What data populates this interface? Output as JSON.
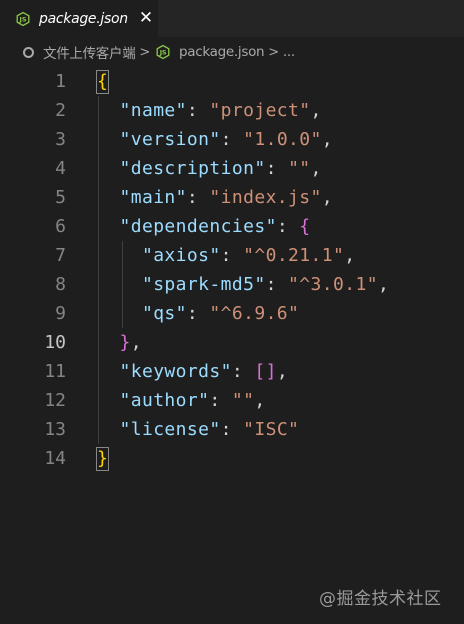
{
  "tab": {
    "icon": "nodejs-icon",
    "label": "package.json",
    "close": "✕"
  },
  "breadcrumb": {
    "folder": "文件上传客户端",
    "sep1": ">",
    "file": "package.json",
    "sep2": ">",
    "ellipsis": "..."
  },
  "editor": {
    "active_line": 10,
    "lines": [
      {
        "n": "1"
      },
      {
        "n": "2"
      },
      {
        "n": "3"
      },
      {
        "n": "4"
      },
      {
        "n": "5"
      },
      {
        "n": "6"
      },
      {
        "n": "7"
      },
      {
        "n": "8"
      },
      {
        "n": "9"
      },
      {
        "n": "10"
      },
      {
        "n": "11"
      },
      {
        "n": "12"
      },
      {
        "n": "13"
      },
      {
        "n": "14"
      }
    ],
    "tokens": {
      "open": "{",
      "name_k": "\"name\"",
      "name_v": "\"project\"",
      "version_k": "\"version\"",
      "version_v": "\"1.0.0\"",
      "desc_k": "\"description\"",
      "desc_v": "\"\"",
      "main_k": "\"main\"",
      "main_v": "\"index.js\"",
      "deps_k": "\"dependencies\"",
      "deps_open": "{",
      "axios_k": "\"axios\"",
      "axios_v": "\"^0.21.1\"",
      "spark_k": "\"spark-md5\"",
      "spark_v": "\"^3.0.1\"",
      "qs_k": "\"qs\"",
      "qs_v": "\"^6.9.6\"",
      "deps_close": "}",
      "kw_k": "\"keywords\"",
      "kw_v": "[]",
      "author_k": "\"author\"",
      "author_v": "\"\"",
      "license_k": "\"license\"",
      "license_v": "\"ISC\"",
      "close": "}"
    }
  },
  "watermark": "@掘金技术社区",
  "colors": {
    "background": "#1e1e1e",
    "key": "#9cdcfe",
    "string": "#ce9178",
    "brace_level1": "#ffd700",
    "brace_level2": "#da70d6",
    "line_number": "#858585"
  }
}
